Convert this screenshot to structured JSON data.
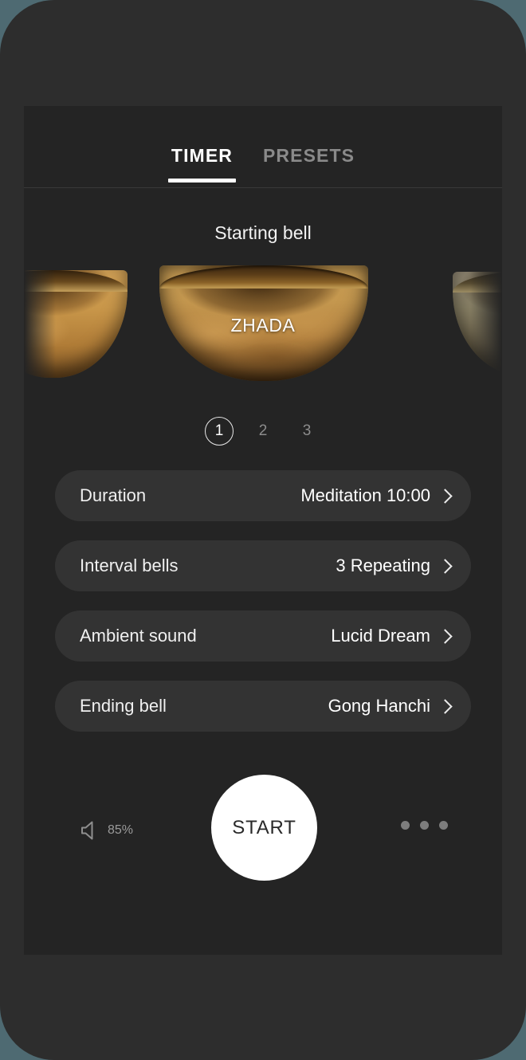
{
  "tabs": [
    {
      "label": "TIMER",
      "active": true
    },
    {
      "label": "PRESETS",
      "active": false
    }
  ],
  "section": {
    "title": "Starting bell"
  },
  "carousel": {
    "selected_label": "ZHADA",
    "pagination": [
      "1",
      "2",
      "3"
    ],
    "active_page": "1"
  },
  "settings": [
    {
      "label": "Duration",
      "value": "Meditation 10:00",
      "chevron": "chevron-right-icon"
    },
    {
      "label": "Interval bells",
      "value": "3 Repeating",
      "chevron": "chevron-right-icon"
    },
    {
      "label": "Ambient sound",
      "value": "Lucid Dream",
      "chevron": "chevron-right-icon"
    },
    {
      "label": "Ending bell",
      "value": "Gong Hanchi",
      "chevron": "chevron-right-icon"
    }
  ],
  "bottom": {
    "volume_icon": "speaker-icon",
    "volume_value": "85%",
    "start_label": "START",
    "more_icon": "more-horizontal-icon"
  },
  "colors": {
    "screen_background": "#242424",
    "device_frame": "#2d2d2d",
    "outer_background": "#4e6a72",
    "row_background": "#333333",
    "accent_white": "#ffffff",
    "muted_text": "#8a8a8a",
    "bowl_gold": "#c49a53"
  }
}
